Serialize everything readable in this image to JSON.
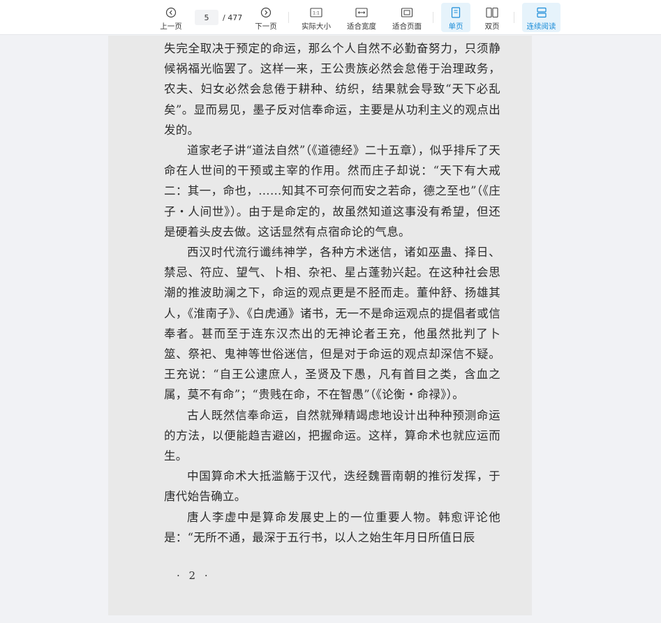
{
  "toolbar": {
    "prev_label": "上一页",
    "next_label": "下一页",
    "current_page": "5",
    "total_pages": "/ 477",
    "actual_size_label": "实际大小",
    "fit_width_label": "适合宽度",
    "fit_page_label": "适合页面",
    "single_page_label": "单页",
    "double_page_label": "双页",
    "continuous_label": "连续阅读",
    "accent_color": "#1a8cd8"
  },
  "document": {
    "paragraphs": [
      "失完全取决于预定的命运，那么个人自然不必勤奋努力，只须静候祸福光临罢了。这样一来，王公贵族必然会怠倦于治理政务，农夫、妇女必然会怠倦于耕种、纺织，结果就会导致“天下必乱矣”。显而易见，墨子反对信奉命运，主要是从功利主义的观点出发的。",
      "道家老子讲“道法自然”（《道德经》二十五章），似乎排斥了天命在人世间的干预或主宰的作用。然而庄子却说：“天下有大戒二：其一，命也，……知其不可奈何而安之若命，德之至也”（《庄子・人间世》）。由于是命定的，故虽然知道这事没有希望，但还是硬着头皮去做。这话显然有点宿命论的气息。",
      "西汉时代流行谶纬神学，各种方术迷信，诸如巫蛊、择日、禁忌、符应、望气、卜相、杂祀、星占蓬勃兴起。在这种社会思潮的推波助澜之下，命运的观点更是不胫而走。董仲舒、扬雄其人，《淮南子》、《白虎通》诸书，无一不是命运观点的提倡者或信奉者。甚而至于连东汉杰出的无神论者王充，他虽然批判了卜筮、祭祀、鬼神等世俗迷信，但是对于命运的观点却深信不疑。王充说：“自王公逮庶人，圣贤及下愚，凡有首目之类，含血之属，莫不有命”；“贵贱在命，不在智愚”（《论衡・命禄》）。",
      "古人既然信奉命运，自然就殚精竭虑地设计出种种预测命运的方法，以便能趋吉避凶，把握命运。这样，算命术也就应运而生。",
      "中国算命术大抵滥觞于汉代，迭经魏晋南朝的推衍发挥，于唐代始告确立。",
      "唐人李虚中是算命发展史上的一位重要人物。韩愈评论他是：“无所不通，最深于五行书，以人之始生年月日所值日辰"
    ],
    "folio": "· 2 ·"
  }
}
